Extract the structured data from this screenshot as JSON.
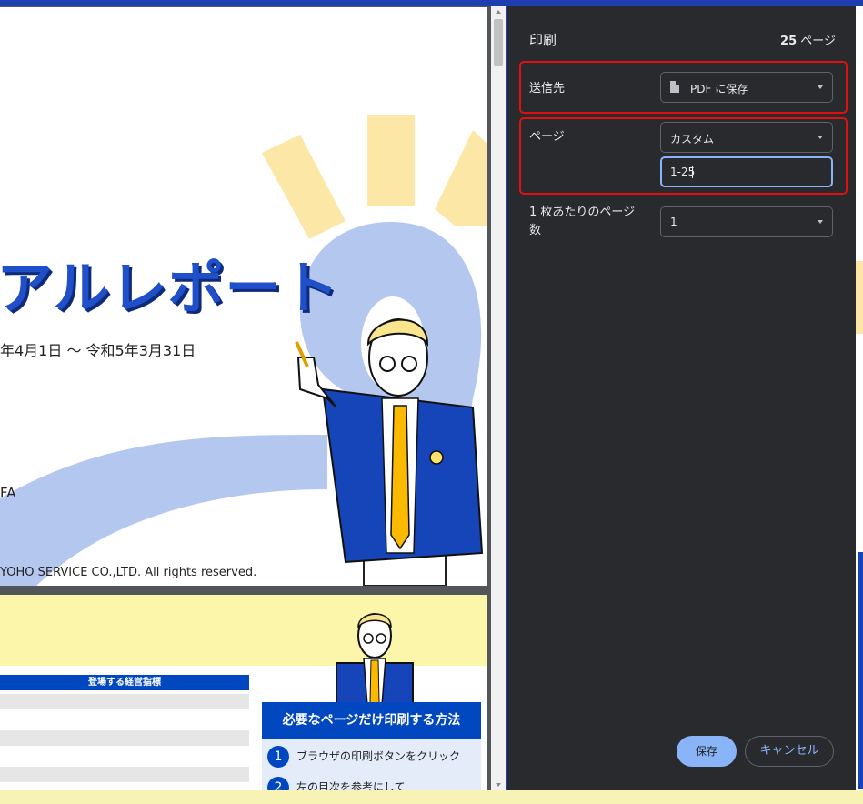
{
  "dialog": {
    "title": "印刷",
    "page_count_num": "25",
    "page_count_unit": " ページ",
    "destination": {
      "label": "送信先",
      "value": "PDF に保存"
    },
    "pages": {
      "label": "ページ",
      "value": "カスタム",
      "range": "1-25"
    },
    "per_sheet": {
      "label_line1": "1 枚あたりのページ",
      "label_line2": "数",
      "value": "1"
    },
    "save_label": "保存",
    "cancel_label": "キャンセル"
  },
  "preview": {
    "page1": {
      "title": "アルレポート",
      "date": "年4月1日 〜 令和5年3月31日",
      "fa": "FA",
      "copyright": "YOHO SERVICE CO.,LTD. All rights reserved."
    },
    "page2": {
      "table_header": "登場する経営指標",
      "panel_title": "必要なページだけ印刷する方法",
      "steps": [
        {
          "num": "1",
          "text": "ブラウザの印刷ボタンをクリック"
        },
        {
          "num": "2",
          "text": "左の目次を参考にして"
        }
      ]
    }
  },
  "colors": {
    "accent": "#8ab4f8",
    "dialog_bg": "#292a2d",
    "highlight": "#e01010",
    "brand_blue": "#1f4fc9"
  }
}
